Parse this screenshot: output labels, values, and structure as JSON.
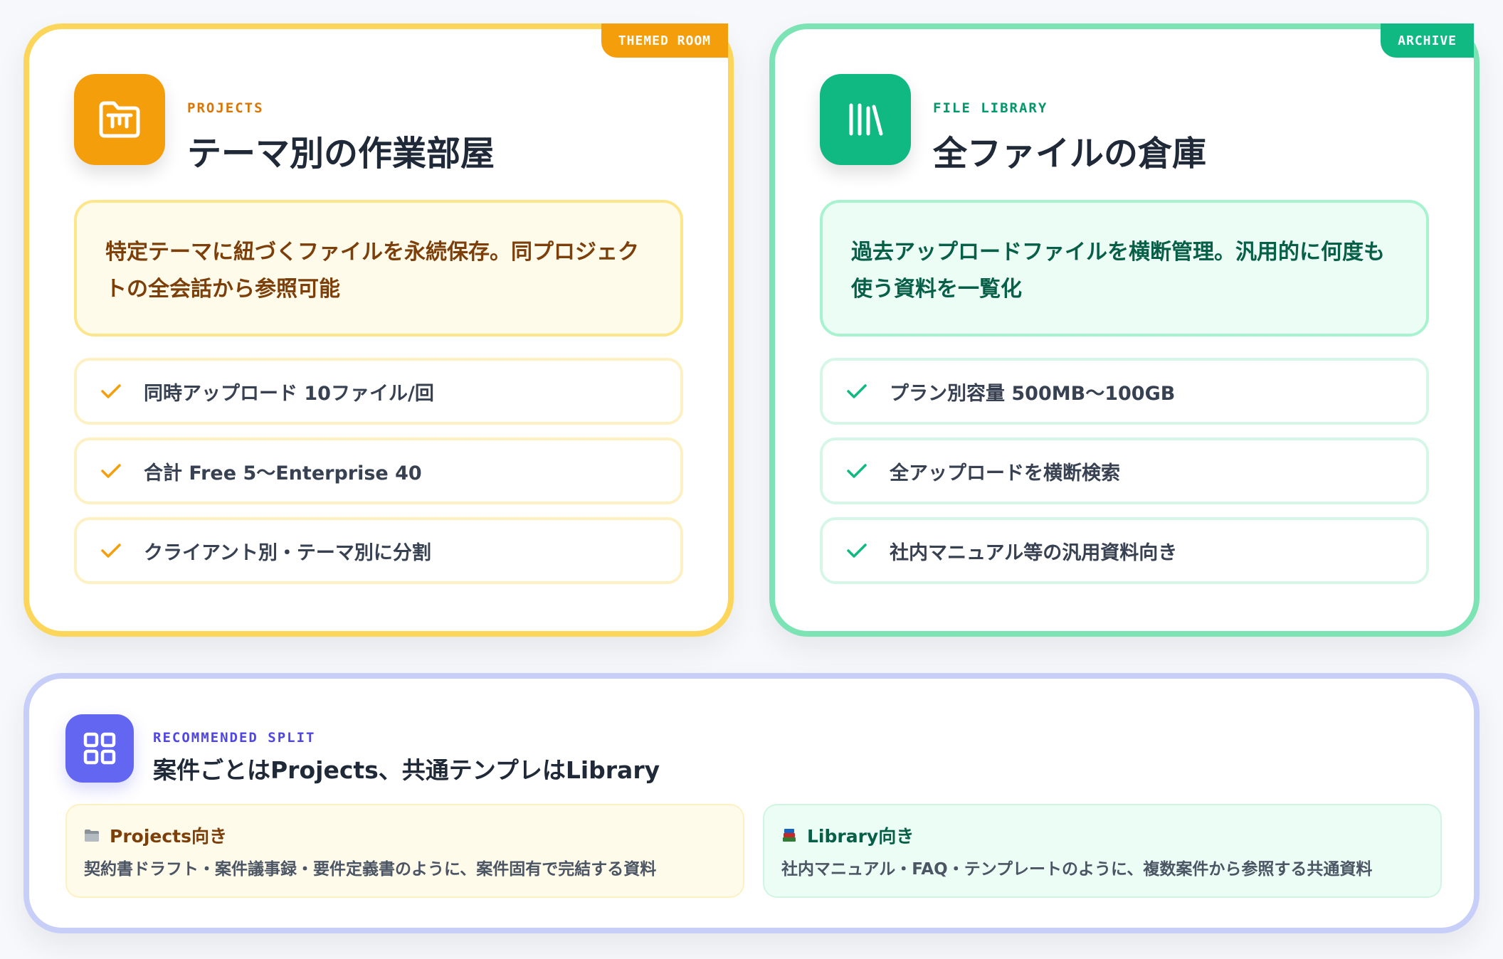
{
  "projects": {
    "tag": "THEMED ROOM",
    "icon": "folder-icon",
    "eyebrow": "PROJECTS",
    "title": "テーマ別の作業部屋",
    "description": "特定テーマに紐づくファイルを永続保存。同プロジェクトの全会話から参照可能",
    "features": [
      "同時アップロード 10ファイル/回",
      "合計 Free 5〜Enterprise 40",
      "クライアント別・テーマ別に分割"
    ],
    "accent": "#f59e0b"
  },
  "library": {
    "tag": "ARCHIVE",
    "icon": "library-icon",
    "eyebrow": "FILE LIBRARY",
    "title": "全ファイルの倉庫",
    "description": "過去アップロードファイルを横断管理。汎用的に何度も使う資料を一覧化",
    "features": [
      "プラン別容量 500MB〜100GB",
      "全アップロードを横断検索",
      "社内マニュアル等の汎用資料向き"
    ],
    "accent": "#10b981"
  },
  "recommended": {
    "icon": "grid-icon",
    "eyebrow": "RECOMMENDED SPLIT",
    "title": "案件ごとはProjects、共通テンプレはLibrary",
    "projects_box": {
      "icon": "folder-emoji-icon",
      "label": "Projects向き",
      "text": "契約書ドラフト・案件議事録・要件定義書のように、案件固有で完結する資料"
    },
    "library_box": {
      "icon": "books-emoji-icon",
      "label": "Library向き",
      "text": "社内マニュアル・FAQ・テンプレートのように、複数案件から参照する共通資料"
    },
    "accent": "#6366f1"
  }
}
